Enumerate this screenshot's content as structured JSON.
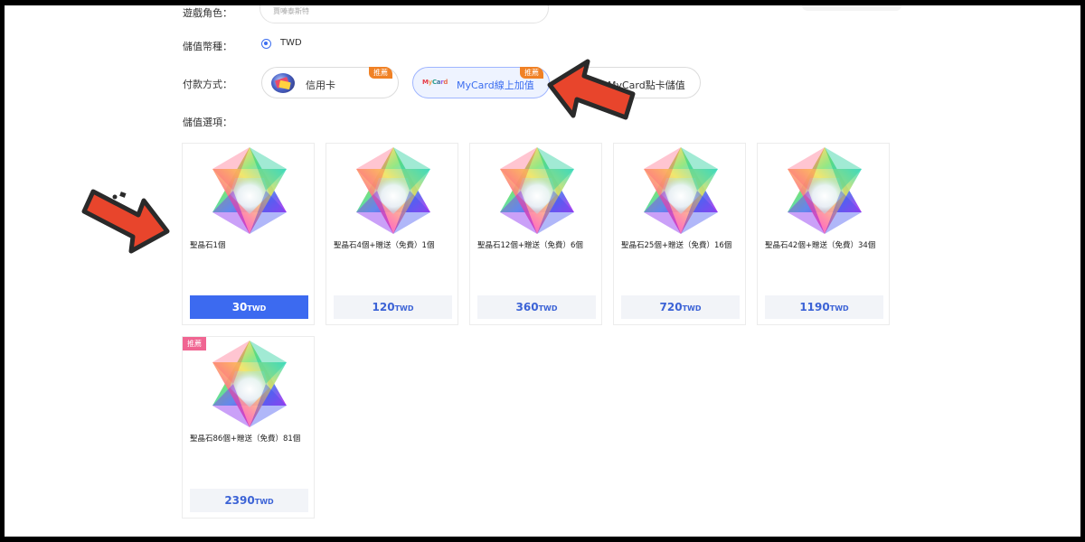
{
  "form": {
    "role_label": "遊戲角色：",
    "role_value": "賈嗪泰斯特",
    "currency_label": "儲值幣種：",
    "currency_value": "TWD",
    "payment_label": "付款方式：",
    "options_label": "儲值選項："
  },
  "payment_methods": [
    {
      "label": "信用卡",
      "badge": "推薦",
      "icon": "credit-card-icon",
      "active": false
    },
    {
      "label": "MyCard線上加值",
      "badge": "推薦",
      "icon": "mycard-logo-icon",
      "logo_text": "MyCard",
      "active": true
    },
    {
      "label": "MyCard點卡儲值",
      "badge": "",
      "icon": "",
      "active": false
    }
  ],
  "packages": [
    {
      "name": "聖晶石1個",
      "amount": "30",
      "currency": "TWD",
      "selected": true,
      "badge": ""
    },
    {
      "name": "聖晶石4個+贈送（免費）1個",
      "amount": "120",
      "currency": "TWD",
      "selected": false,
      "badge": ""
    },
    {
      "name": "聖晶石12個+贈送（免費）6個",
      "amount": "360",
      "currency": "TWD",
      "selected": false,
      "badge": ""
    },
    {
      "name": "聖晶石25個+贈送（免費）16個",
      "amount": "720",
      "currency": "TWD",
      "selected": false,
      "badge": ""
    },
    {
      "name": "聖晶石42個+贈送（免費）34個",
      "amount": "1190",
      "currency": "TWD",
      "selected": false,
      "badge": ""
    },
    {
      "name": "聖晶石86個+贈送（免費）81個",
      "amount": "2390",
      "currency": "TWD",
      "selected": false,
      "badge": "推薦"
    }
  ],
  "colors": {
    "accent": "#3c6af0",
    "badge_orange": "#f08125",
    "badge_pink": "#f06592",
    "arrow_red": "#e8452c"
  }
}
